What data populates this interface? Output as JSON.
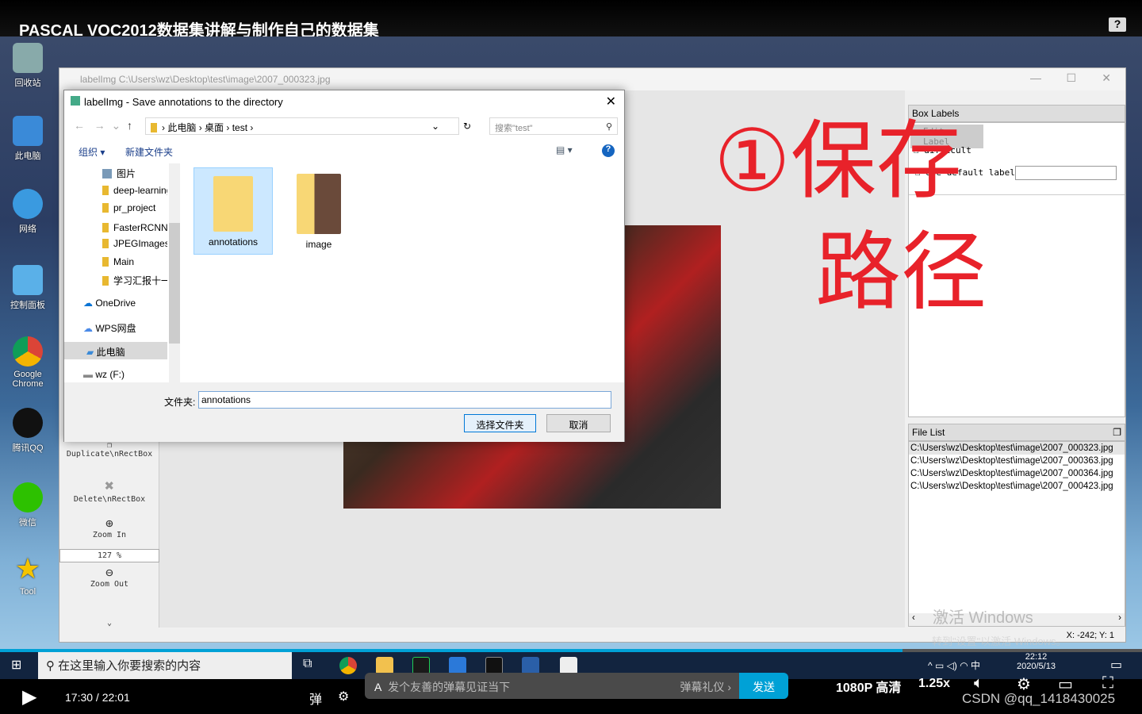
{
  "video": {
    "title": "PASCAL VOC2012数据集讲解与制作自己的数据集",
    "help_icon": "help-icon"
  },
  "desktop_icons": [
    {
      "label": "回收站"
    },
    {
      "label": "此电脑"
    },
    {
      "label": "网络"
    },
    {
      "label": "控制面板"
    },
    {
      "label": "Google Chrome"
    },
    {
      "label": "腾讯QQ"
    },
    {
      "label": "微信"
    },
    {
      "label": "Tool"
    }
  ],
  "labelimg": {
    "title": "labelImg C:\\Users\\wz\\Desktop\\test\\image\\2007_000323.jpg",
    "tools": {
      "duplicate": "Duplicate\\nRectBox",
      "delete": "Delete\\nRectBox",
      "zoom_in": "Zoom In",
      "zoom_value": "127 %",
      "zoom_out": "Zoom Out"
    },
    "box_labels": {
      "title": "Box Labels",
      "edit_label": "Edit Label",
      "difficult": "difficult",
      "use_default": "Use default label",
      "default_value": ""
    },
    "file_list": {
      "title": "File List",
      "items": [
        "C:\\Users\\wz\\Desktop\\test\\image\\2007_000323.jpg",
        "C:\\Users\\wz\\Desktop\\test\\image\\2007_000363.jpg",
        "C:\\Users\\wz\\Desktop\\test\\image\\2007_000364.jpg",
        "C:\\Users\\wz\\Desktop\\test\\image\\2007_000423.jpg"
      ]
    },
    "status": "X: -242; Y: 1",
    "activate1": "激活 Windows",
    "activate2": "转到\"设置\"以激活 Windows。"
  },
  "dialog": {
    "title": "labelImg - Save annotations to the directory",
    "breadcrumb": [
      "此电脑",
      "桌面",
      "test"
    ],
    "search_placeholder": "搜索\"test\"",
    "organize": "组织 ▾",
    "new_folder": "新建文件夹",
    "nav": [
      "图片",
      "deep-learning",
      "pr_project",
      "FasterRCNN理论",
      "JPEGImages",
      "Main",
      "学习汇报十一",
      "OneDrive",
      "WPS网盘",
      "此电脑",
      "wz (F:)"
    ],
    "files": [
      {
        "name": "annotations",
        "selected": true
      },
      {
        "name": "image",
        "selected": false
      }
    ],
    "folder_label": "文件夹:",
    "folder_value": "annotations",
    "select_button": "选择文件夹",
    "cancel_button": "取消"
  },
  "annotation": {
    "line1": "①保存",
    "line2": "路径",
    "color": "#e8222a"
  },
  "taskbar": {
    "search": "在这里输入你要搜索的内容",
    "time": "22:12",
    "date": "2020/5/13",
    "ime": "中"
  },
  "player": {
    "time": "17:30 / 22:01",
    "danmaku_placeholder": "发个友善的弹幕见证当下",
    "etiquette": "弹幕礼仪 ›",
    "send": "发送",
    "quality": "1080P 高清",
    "speed": "1.25x",
    "progress": 0.79,
    "watermark": "CSDN @qq_1418430025",
    "accent": "#00a1d6"
  }
}
